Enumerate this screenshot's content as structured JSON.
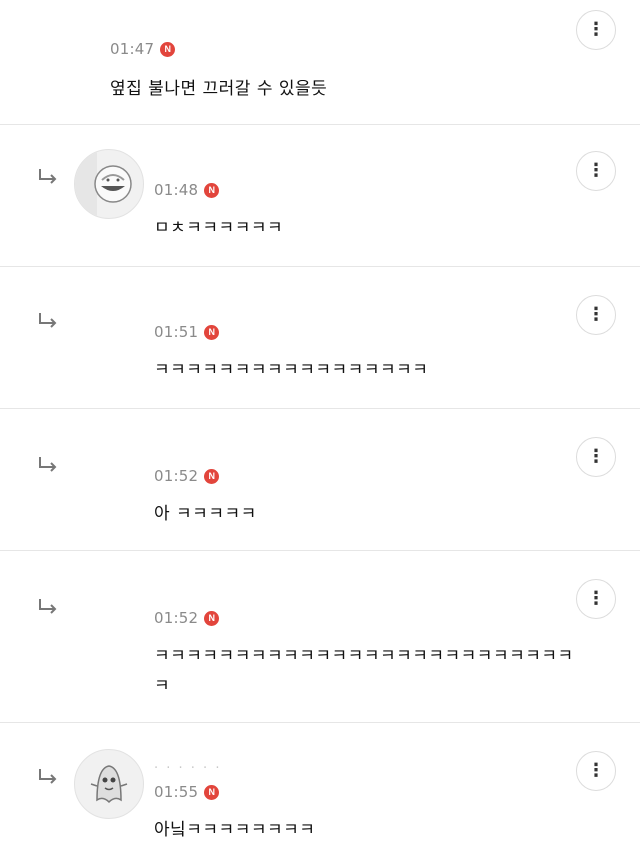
{
  "comments": [
    {
      "time": "01:47",
      "badge": "N",
      "text": "옆집 불나면 끄러갈 수 있을듯",
      "reply": false,
      "avatar": null
    },
    {
      "time": "01:48",
      "badge": "N",
      "text": "ㅁㅊㅋㅋㅋㅋㅋㅋ",
      "reply": true,
      "avatar": "character-avatar"
    },
    {
      "time": "01:51",
      "badge": "N",
      "text": "ㅋㅋㅋㅋㅋㅋㅋㅋㅋㅋㅋㅋㅋㅋㅋㅋㅋ",
      "reply": true,
      "avatar": null
    },
    {
      "time": "01:52",
      "badge": "N",
      "text": "아 ㅋㅋㅋㅋㅋ",
      "reply": true,
      "avatar": null
    },
    {
      "time": "01:52",
      "badge": "N",
      "text": "ㅋㅋㅋㅋㅋㅋㅋㅋㅋㅋㅋㅋㅋㅋㅋㅋㅋㅋㅋㅋㅋㅋㅋㅋㅋㅋㅋ",
      "reply": true,
      "avatar": null
    },
    {
      "time": "01:55",
      "badge": "N",
      "text": "아닠ㅋㅋㅋㅋㅋㅋㅋㅋ",
      "reply": true,
      "avatar": "ghost-avatar",
      "nickname": ". . .    . . ."
    }
  ],
  "more_icon": "⋮",
  "colors": {
    "badge": "#e2453c",
    "time": "#8a8a8a",
    "divider": "#e6e6e6"
  }
}
